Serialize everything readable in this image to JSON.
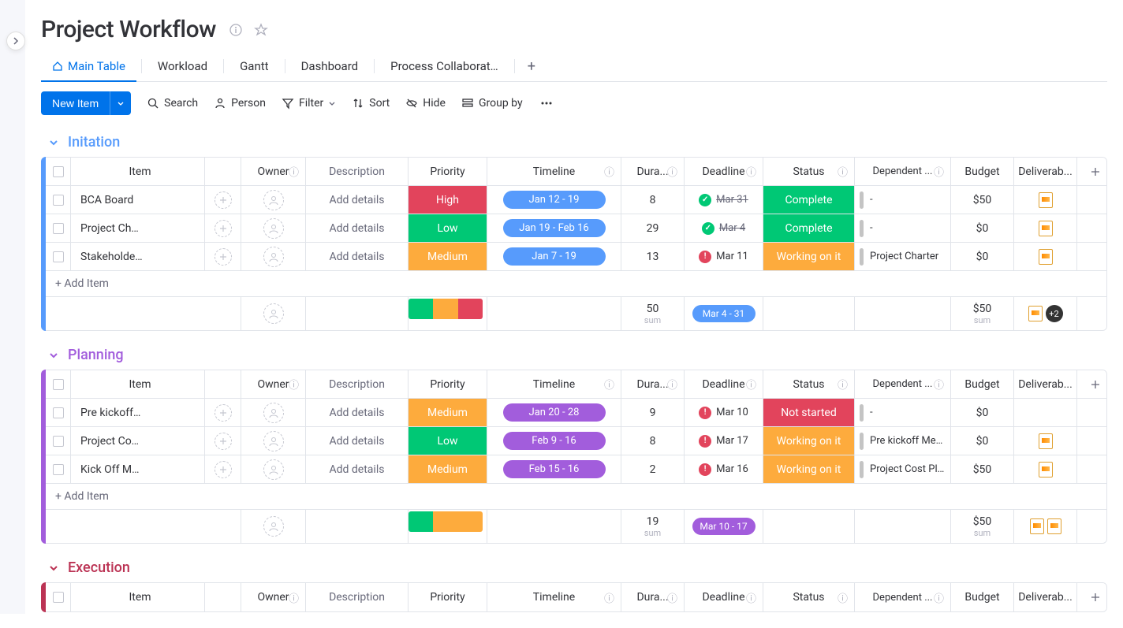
{
  "header": {
    "title": "Project Workflow"
  },
  "tabs": [
    {
      "label": "Main Table",
      "active": true
    },
    {
      "label": "Workload"
    },
    {
      "label": "Gantt"
    },
    {
      "label": "Dashboard"
    },
    {
      "label": "Process Collaborat…"
    }
  ],
  "toolbar": {
    "newItem": "New Item",
    "search": "Search",
    "person": "Person",
    "filter": "Filter",
    "sort": "Sort",
    "hide": "Hide",
    "groupBy": "Group by"
  },
  "columns": {
    "item": "Item",
    "owner": "Owner",
    "description": "Description",
    "priority": "Priority",
    "timeline": "Timeline",
    "duration": "Dura...",
    "deadline": "Deadline",
    "status": "Status",
    "dependent": "Dependent ...",
    "budget": "Budget",
    "deliverable": "Deliverab..."
  },
  "addItemLabel": "+ Add Item",
  "addDetailsLabel": "Add details",
  "groups": [
    {
      "title": "Initation",
      "color": "#579bfc",
      "items": [
        {
          "name": "BCA Board",
          "priority": "High",
          "priorityColor": "#e2445c",
          "timeline": "Jan 12 - 19",
          "timelineColor": "#579bfc",
          "duration": "8",
          "deadline": "Mar 31",
          "deadlineIcon": "done",
          "deadlineStrike": true,
          "status": "Complete",
          "statusColor": "#00c875",
          "dependent": "-",
          "depBar": "#c4c4c4",
          "budget": "$50",
          "hasFile": true
        },
        {
          "name": "Project Ch…",
          "priority": "Low",
          "priorityColor": "#00c875",
          "timeline": "Jan 19 - Feb 16",
          "timelineColor": "#579bfc",
          "duration": "29",
          "deadline": "Mar 4",
          "deadlineIcon": "done",
          "deadlineStrike": true,
          "status": "Complete",
          "statusColor": "#00c875",
          "dependent": "-",
          "depBar": "#c4c4c4",
          "budget": "$0",
          "hasFile": true
        },
        {
          "name": "Stakeholde…",
          "priority": "Medium",
          "priorityColor": "#fdab3d",
          "timeline": "Jan 7 - 19",
          "timelineColor": "#579bfc",
          "duration": "13",
          "deadline": "Mar 11",
          "deadlineIcon": "late",
          "deadlineStrike": false,
          "status": "Working on it",
          "statusColor": "#fdab3d",
          "dependent": "Project Charter",
          "depBar": "#c4c4c4",
          "budget": "$0",
          "hasFile": true
        }
      ],
      "summary": {
        "durationSum": "50",
        "timelineRange": "Mar 4 - 31",
        "timelineColor": "#579bfc",
        "budgetSum": "$50",
        "fileBadge": "+2",
        "prioritySegs": [
          "#00c875",
          "#fdab3d",
          "#e2445c"
        ]
      }
    },
    {
      "title": "Planning",
      "color": "#a25ddc",
      "items": [
        {
          "name": "Pre kickoff…",
          "priority": "Medium",
          "priorityColor": "#fdab3d",
          "timeline": "Jan 20 - 28",
          "timelineColor": "#a25ddc",
          "duration": "9",
          "deadline": "Mar 10",
          "deadlineIcon": "late",
          "deadlineStrike": false,
          "status": "Not started",
          "statusColor": "#e2445c",
          "dependent": "-",
          "depBar": "#c4c4c4",
          "budget": "$0",
          "hasFile": false
        },
        {
          "name": "Project Co…",
          "priority": "Low",
          "priorityColor": "#00c875",
          "timeline": "Feb 9 - 16",
          "timelineColor": "#a25ddc",
          "duration": "8",
          "deadline": "Mar 17",
          "deadlineIcon": "late",
          "deadlineStrike": false,
          "status": "Working on it",
          "statusColor": "#fdab3d",
          "dependent": "Pre kickoff Mee…",
          "depBar": "#c4c4c4",
          "budget": "$0",
          "hasFile": true
        },
        {
          "name": "Kick Off M…",
          "priority": "Medium",
          "priorityColor": "#fdab3d",
          "timeline": "Feb 15 - 16",
          "timelineColor": "#a25ddc",
          "duration": "2",
          "deadline": "Mar 16",
          "deadlineIcon": "late",
          "deadlineStrike": false,
          "status": "Working on it",
          "statusColor": "#fdab3d",
          "dependent": "Project Cost Plan",
          "depBar": "#c4c4c4",
          "budget": "$50",
          "hasFile": true
        }
      ],
      "summary": {
        "durationSum": "19",
        "timelineRange": "Mar 10 - 17",
        "timelineColor": "#a25ddc",
        "budgetSum": "$50",
        "fileBadge": "",
        "extraFile": true,
        "prioritySegs": [
          "#00c875",
          "#fdab3d",
          "#fdab3d"
        ]
      }
    },
    {
      "title": "Execution",
      "color": "#bb3354",
      "items": [],
      "summary": null
    }
  ],
  "sumLabel": "sum"
}
